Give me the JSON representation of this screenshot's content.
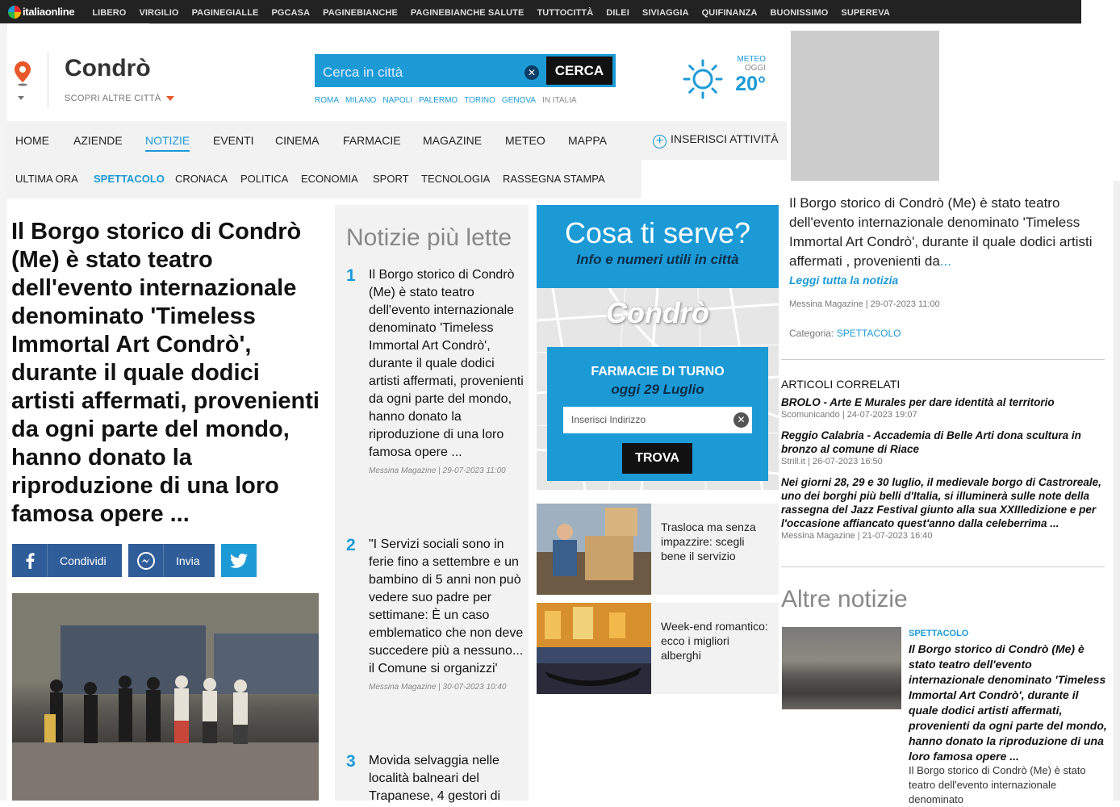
{
  "topbar": {
    "logo": "italiaonline",
    "links": [
      "LIBERO",
      "VIRGILIO",
      "PAGINEGIALLE",
      "PGCASA",
      "PAGINEBIANCHE",
      "PAGINEBIANCHE SALUTE",
      "TUTTOCITTÀ",
      "DILEI",
      "SIVIAGGIA",
      "QUIFINANZA",
      "BUONISSIMO",
      "SUPEREVA"
    ]
  },
  "header": {
    "city": "Condrò",
    "other_cities": "SCOPRI ALTRE CITTÀ",
    "search_placeholder": "Cerca in città",
    "search_button": "CERCA",
    "quick_cities": [
      "ROMA",
      "MILANO",
      "NAPOLI",
      "PALERMO",
      "TORINO",
      "GENOVA"
    ],
    "quick_italy": "IN ITALIA",
    "meteo_label": "METEO",
    "meteo_day": "OGGI",
    "meteo_temp": "20°"
  },
  "nav": {
    "items": [
      "HOME",
      "AZIENDE",
      "NOTIZIE",
      "EVENTI",
      "CINEMA",
      "FARMACIE",
      "MAGAZINE",
      "METEO",
      "MAPPA"
    ],
    "active": "NOTIZIE",
    "insert": "INSERISCI ATTIVITÀ"
  },
  "subnav": {
    "items": [
      "ULTIMA ORA",
      "SPETTACOLO",
      "CRONACA",
      "POLITICA",
      "ECONOMIA",
      "SPORT",
      "TECNOLOGIA",
      "RASSEGNA STAMPA"
    ],
    "active": "SPETTACOLO"
  },
  "article": {
    "headline": "Il Borgo storico di Condrò (Me) è stato teatro dell'evento internazionale denominato 'Timeless Immortal Art Condrò', durante il quale dodici artisti affermati, provenienti da ogni parte del mondo, hanno donato la riproduzione di una loro famosa opere ...",
    "share_facebook": "Condividi",
    "share_messenger": "Invia"
  },
  "popular": {
    "title": "Notizie più lette",
    "items": [
      {
        "num": "1",
        "title": "Il Borgo storico di Condrò (Me) è stato teatro dell'evento internazionale denominato 'Timeless Immortal Art Condrò', durante il quale dodici artisti affermati, provenienti da ogni parte del mondo, hanno donato la riproduzione di una loro famosa opere ...",
        "meta": "Messina Magazine | 29-07-2023 11:00"
      },
      {
        "num": "2",
        "title": "\"I Servizi sociali sono in ferie fino a settembre e un bambino di 5 anni non può vedere suo padre per settimane: È un caso emblematico che non deve succedere più a nessuno... il Comune si organizzi'",
        "meta": "Messina Magazine | 30-07-2023 10:40"
      },
      {
        "num": "3",
        "title": "Movida selvaggia nelle località balneari del Trapanese, 4 gestori di",
        "meta": ""
      }
    ]
  },
  "services": {
    "title": "Cosa ti serve?",
    "subtitle": "Info e numeri utili in città",
    "map_city": "Condrò",
    "pharmacy_title": "FARMACIE DI TURNO",
    "pharmacy_date": "oggi 29 Luglio",
    "address_placeholder": "Inserisci Indirizzo",
    "find_button": "TROVA"
  },
  "promos": [
    {
      "text": "Trasloca ma senza impazzire: scegli bene il servizio"
    },
    {
      "text": "Week-end romantico: ecco i migliori alberghi"
    }
  ],
  "right": {
    "excerpt": "Il Borgo storico di Condrò (Me) è stato teatro dell'evento internazionale denominato 'Timeless Immortal Art Condrò', durante il quale dodici artisti affermati , provenienti da",
    "ellipsis": "...",
    "read_all": "Leggi tutta la notizia",
    "meta": "Messina Magazine | 29-07-2023 11:00",
    "category_label": "Categoria:",
    "category": "SPETTACOLO",
    "related_title": "ARTICOLI CORRELATI",
    "related": [
      {
        "title": "BROLO - Arte E Murales per dare identità al territorio",
        "meta": "Scomunicando | 24-07-2023 19:07"
      },
      {
        "title": "Reggio Calabria - Accademia di Belle Arti dona scultura in bronzo al comune di Riace",
        "meta": "Strill.it | 26-07-2023 16:50"
      },
      {
        "title": "Nei giorni 28, 29 e 30 luglio, il medievale borgo di Castroreale, uno dei borghi più belli d'Italia, si illuminerà sulle note della rassegna del Jazz Festival giunto alla sua XXIIIedizione e per l'occasione affiancato quest'anno dalla celeberrima ...",
        "meta": "Messina Magazine | 21-07-2023 16:40"
      }
    ],
    "other_title": "Altre notizie",
    "other_category": "SPETTACOLO",
    "other_headline": "Il Borgo storico di Condrò (Me) è stato teatro dell'evento internazionale denominato 'Timeless Immortal Art Condrò', durante il quale dodici artisti affermati, provenienti da ogni parte del mondo, hanno donato la riproduzione di una loro famosa opere ...",
    "other_summary": "Il Borgo storico di Condrò (Me) è stato teatro dell'evento internazionale denominato"
  },
  "colors": {
    "accent": "#1c9ad6",
    "topbar": "#222222",
    "facebook": "#2f5d99",
    "map_bg": "#e6e6e6"
  }
}
